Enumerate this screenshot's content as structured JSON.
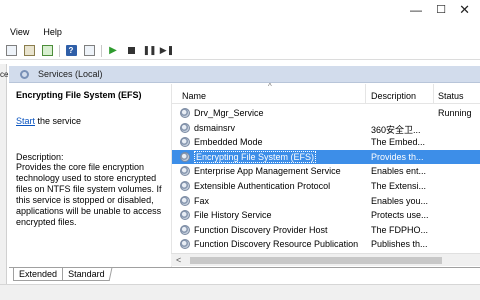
{
  "window": {
    "minimize_glyph": "—",
    "maximize_glyph": "☐",
    "close_glyph": "✕"
  },
  "menu": {
    "items": [
      "View",
      "Help"
    ]
  },
  "toolbar": {
    "buttons": [
      "back-icon",
      "forward-icon",
      "console-tree-icon",
      "properties-icon",
      "refresh-icon",
      "help-icon",
      "export-icon",
      "start-icon",
      "stop-icon",
      "pause-icon",
      "restart-icon"
    ],
    "help_glyph": "?",
    "play_glyph": "▶",
    "pause_glyph": "❚❚",
    "restart_glyph": "▶❚"
  },
  "left_strip_fragment": "ce",
  "header": {
    "title": "Services (Local)"
  },
  "detail": {
    "service_title": "Encrypting File System (EFS)",
    "start_link": "Start",
    "start_suffix": " the service",
    "description_label": "Description:",
    "description_text": "Provides the core file encryption technology used to store encrypted files on NTFS file system volumes. If this service is stopped or disabled, applications will be unable to access encrypted files."
  },
  "columns": {
    "name": "Name",
    "description": "Description",
    "status": "Status",
    "sort_glyph": "^"
  },
  "services": [
    {
      "name": "Drv_Mgr_Service",
      "description": "",
      "status": "Running"
    },
    {
      "name": "dsmainsrv",
      "description": "360安全卫...",
      "status": ""
    },
    {
      "name": "Embedded Mode",
      "description": "The Embed...",
      "status": ""
    },
    {
      "name": "Encrypting File System (EFS)",
      "description": "Provides th...",
      "status": ""
    },
    {
      "name": "Enterprise App Management Service",
      "description": "Enables ent...",
      "status": ""
    },
    {
      "name": "Extensible Authentication Protocol",
      "description": "The Extensi...",
      "status": ""
    },
    {
      "name": "Fax",
      "description": "Enables you...",
      "status": ""
    },
    {
      "name": "File History Service",
      "description": "Protects use...",
      "status": ""
    },
    {
      "name": "Function Discovery Provider Host",
      "description": "The FDPHO...",
      "status": ""
    },
    {
      "name": "Function Discovery Resource Publication",
      "description": "Publishes th...",
      "status": ""
    }
  ],
  "selected_index": 3,
  "scroll": {
    "left_arrow": "<"
  },
  "tabs": {
    "extended": "Extended",
    "standard": "Standard"
  },
  "colors": {
    "selection": "#3d8ee8",
    "header_band": "#d2dcec",
    "link": "#0a54c0"
  }
}
